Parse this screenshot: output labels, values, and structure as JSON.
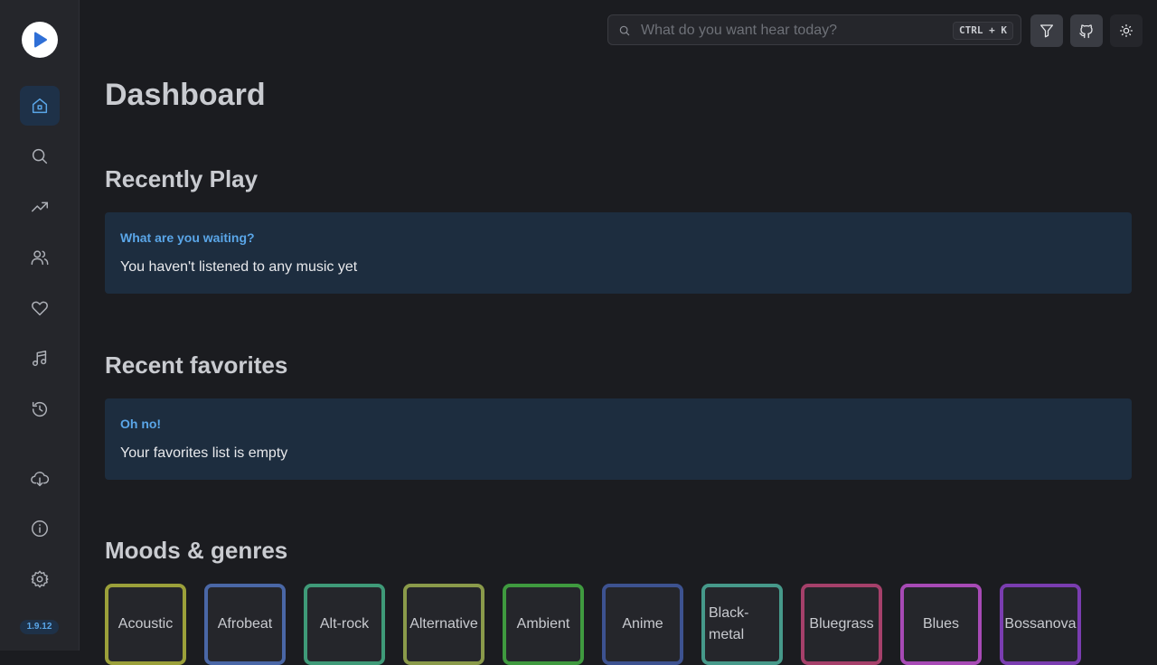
{
  "app": {
    "version": "1.9.12"
  },
  "sidebar": {
    "items": [
      {
        "icon": "home-icon",
        "active": true
      },
      {
        "icon": "search-icon"
      },
      {
        "icon": "trending-icon"
      },
      {
        "icon": "users-icon"
      },
      {
        "icon": "heart-icon"
      },
      {
        "icon": "music-note-icon"
      },
      {
        "icon": "history-icon"
      },
      {
        "icon": "cloud-download-icon"
      },
      {
        "icon": "info-icon"
      },
      {
        "icon": "gear-icon"
      }
    ]
  },
  "header": {
    "search_placeholder": "What do you want hear today?",
    "search_value": "",
    "shortcut": "CTRL + K",
    "buttons": [
      "filter-icon",
      "github-icon",
      "sun-icon"
    ]
  },
  "main": {
    "title": "Dashboard",
    "recently_play": {
      "heading": "Recently Play",
      "alert_title": "What are you waiting?",
      "alert_message": "You haven't listened to any music yet"
    },
    "recent_favorites": {
      "heading": "Recent favorites",
      "alert_title": "Oh no!",
      "alert_message": "Your favorites list is empty"
    },
    "moods": {
      "heading": "Moods & genres",
      "genres": [
        {
          "label": "Acoustic",
          "color": "#9ba03a"
        },
        {
          "label": "Afrobeat",
          "color": "#4a67a6"
        },
        {
          "label": "Alt-rock",
          "color": "#3f9a78"
        },
        {
          "label": "Alternative",
          "color": "#8a9a4a"
        },
        {
          "label": "Ambient",
          "color": "#3f9a3f"
        },
        {
          "label": "Anime",
          "color": "#3d5290"
        },
        {
          "label": "Black-metal",
          "color": "#46998a"
        },
        {
          "label": "Bluegrass",
          "color": "#a5406a"
        },
        {
          "label": "Blues",
          "color": "#a74ab5"
        },
        {
          "label": "Bossanova",
          "color": "#7a3db0"
        }
      ]
    }
  }
}
